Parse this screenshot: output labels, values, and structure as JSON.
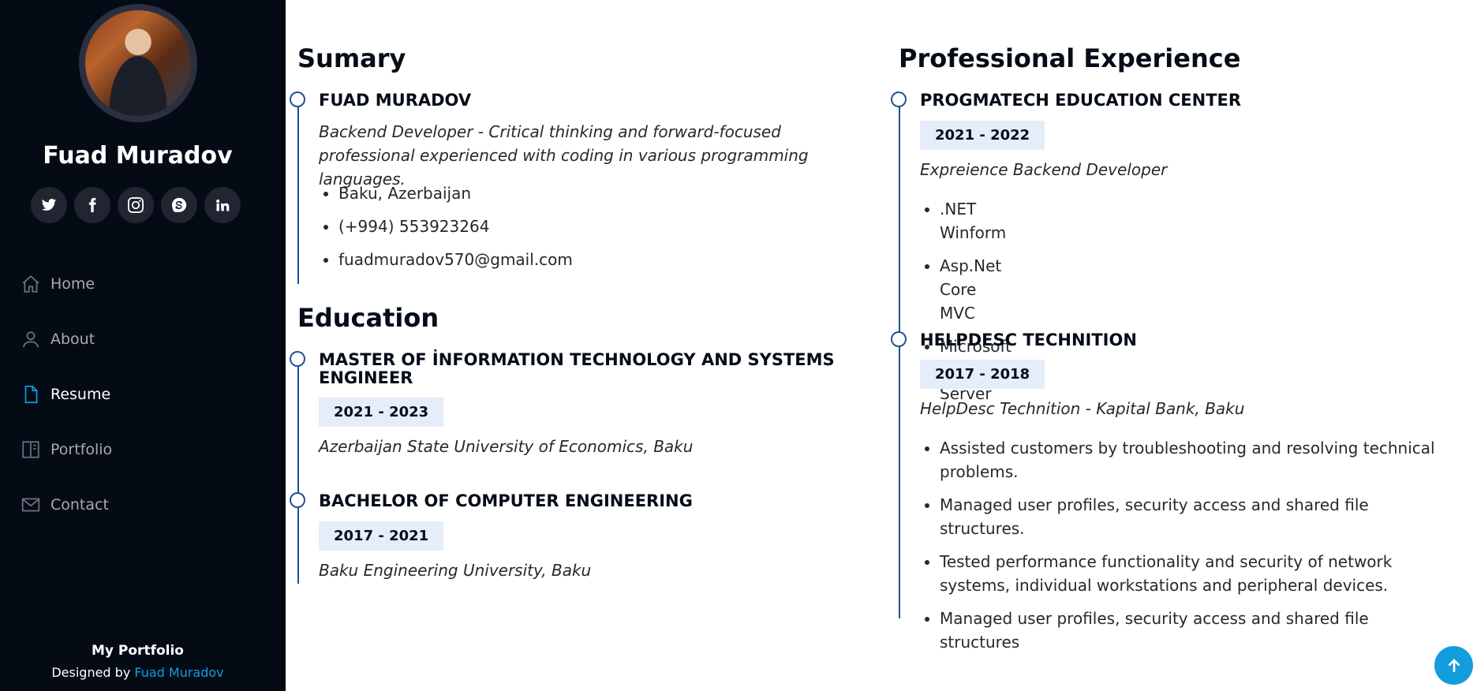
{
  "sidebar": {
    "name": "Fuad Muradov",
    "social": [
      "twitter-icon",
      "facebook-icon",
      "instagram-icon",
      "skype-icon",
      "linkedin-icon"
    ],
    "nav": [
      {
        "label": "Home",
        "icon": "home-icon"
      },
      {
        "label": "About",
        "icon": "user-icon"
      },
      {
        "label": "Resume",
        "icon": "file-icon",
        "active": true
      },
      {
        "label": "Portfolio",
        "icon": "book-icon"
      },
      {
        "label": "Contact",
        "icon": "envelope-icon"
      }
    ],
    "footer": {
      "brand": "My Portfolio",
      "designed_by": "Designed by ",
      "author": "Fuad Muradov"
    }
  },
  "summary": {
    "title": "Sumary",
    "name": "FUAD MURADOV",
    "desc": "Backend Developer - Critical thinking and forward-focused professional experienced with coding in various programming languages.",
    "items": [
      "Baku, Azerbaijan",
      "(+994) 553923264",
      "fuadmuradov570@gmail.com"
    ]
  },
  "education": {
    "title": "Education",
    "items": [
      {
        "title": "MASTER OF İNFORMATION TECHNOLOGY AND SYSTEMS ENGINEER",
        "date": "2021 - 2023",
        "desc": "Azerbaijan State University of Economics, Baku"
      },
      {
        "title": "BACHELOR OF COMPUTER ENGINEERING",
        "date": "2017 - 2021",
        "desc": "Baku Engineering University, Baku"
      }
    ]
  },
  "experience": {
    "title": "Professional Experience",
    "items": [
      {
        "title": "PROGMATECH EDUCATION CENTER",
        "date": "2021 - 2022",
        "desc": "Expreience Backend Developer",
        "points": [
          ".NET Winform",
          "Asp.Net Core MVC",
          "Microsoft SQL Server"
        ]
      },
      {
        "title": "HELPDESC TECHNITION",
        "date": "2017 - 2018",
        "desc": "HelpDesc Technition - Kapital Bank, Baku",
        "points": [
          "Assisted customers by troubleshooting and resolving technical problems.",
          "Managed user profiles, security access and shared file structures.",
          "Tested performance functionality and security of network systems, individual workstations and peripheral devices.",
          "Managed user profiles, security access and shared file structures"
        ]
      }
    ]
  }
}
